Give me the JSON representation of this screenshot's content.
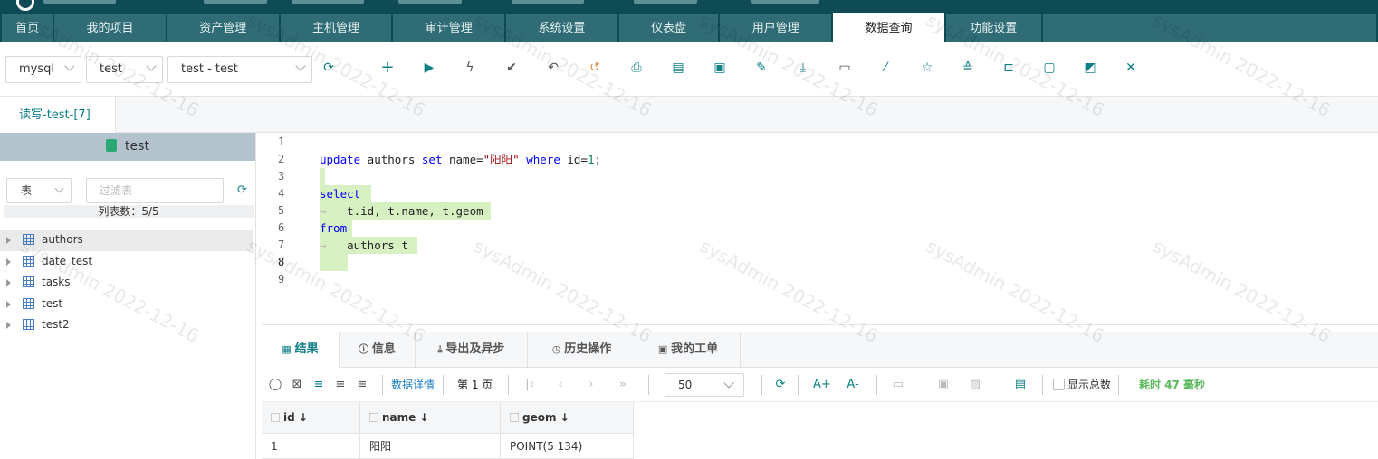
{
  "nav": {
    "tabs": [
      {
        "label": "首页"
      },
      {
        "label": "我的项目"
      },
      {
        "label": "资产管理"
      },
      {
        "label": "主机管理"
      },
      {
        "label": "审计管理"
      },
      {
        "label": "系统设置"
      },
      {
        "label": "仪表盘"
      },
      {
        "label": "用户管理"
      },
      {
        "label": "数据查询",
        "active": true
      },
      {
        "label": "功能设置"
      }
    ]
  },
  "toolbar": {
    "db_type": "mysql",
    "database": "test",
    "connection": "test - test",
    "icons": [
      "refresh-icon",
      "add-icon",
      "run-icon",
      "lightning-icon",
      "check-icon",
      "undo-icon",
      "history-icon",
      "print-icon",
      "clipboard-icon",
      "calendar-icon",
      "edit-file-icon",
      "download-icon",
      "image-icon",
      "magic-wand-icon",
      "star-icon",
      "stack-icon",
      "folder-open-icon",
      "save-icon",
      "export-icon",
      "tools-icon"
    ]
  },
  "query_tab": {
    "label": "读写-test-[7]"
  },
  "sidebar": {
    "db_name": "test",
    "kind_select": "表",
    "filter_placeholder": "过滤表",
    "count_label": "列表数：5/5",
    "tables": [
      {
        "name": "authors"
      },
      {
        "name": "date_test"
      },
      {
        "name": "tasks"
      },
      {
        "name": "test"
      },
      {
        "name": "test2"
      }
    ]
  },
  "editor": {
    "line_numbers": [
      "1",
      "2",
      "3",
      "4",
      "5",
      "6",
      "7",
      "8",
      "9"
    ],
    "update_kw": "update",
    "update_table": " authors ",
    "set_kw": "set",
    "set_col": " name=",
    "set_val": "\"阳阳\"",
    "where_kw": " where",
    "where_col": " id=",
    "where_val": "1",
    "semi": ";",
    "select_kw": "select",
    "select_cols": "   t.id, t.name, t.geom",
    "from_kw": "from",
    "from_table": "   authors t",
    "indent_arrow": "→"
  },
  "result": {
    "tabs": [
      {
        "label": "结果",
        "icon": "grid-icon"
      },
      {
        "label": "信息",
        "icon": "info-icon"
      },
      {
        "label": "导出及异步",
        "icon": "export-icon"
      },
      {
        "label": "历史操作",
        "icon": "clock-icon"
      },
      {
        "label": "我的工单",
        "icon": "ticket-icon"
      }
    ],
    "detail_link": "数据详情",
    "page_label": "第 1 页",
    "page_size": "50",
    "show_total": "显示总数",
    "elapsed": "耗时 47 毫秒",
    "columns": [
      "id",
      "name",
      "geom"
    ],
    "rows": [
      [
        "1",
        "阳阳",
        "POINT(5 134)"
      ]
    ]
  },
  "watermark": "sysAdmin 2022-12-16"
}
